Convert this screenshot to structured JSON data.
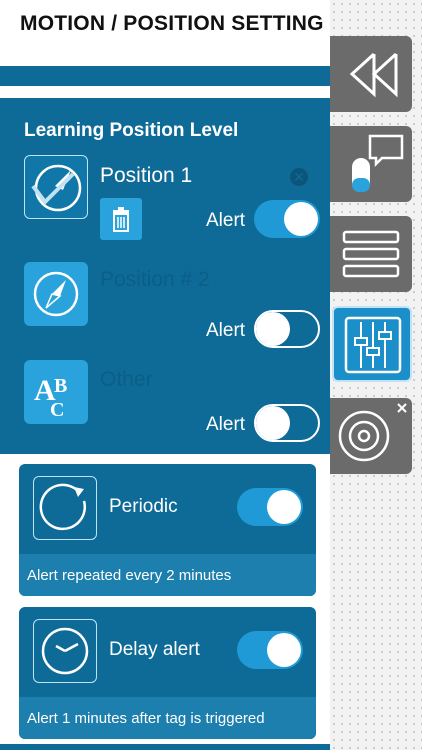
{
  "header": {
    "title": "MOTION / POSITION SETTING"
  },
  "learning": {
    "title": "Learning Position Level",
    "positions": [
      {
        "label": "Position 1",
        "alert_label": "Alert",
        "alert_on": true
      },
      {
        "label": "Position # 2",
        "alert_label": "Alert",
        "alert_on": false
      },
      {
        "label": "Other",
        "alert_label": "Alert",
        "alert_on": false
      }
    ]
  },
  "periodic": {
    "title": "Periodic",
    "note": "Alert repeated every 2 minutes",
    "enabled": true
  },
  "delay": {
    "title": "Delay alert",
    "note": "Alert 1 minutes after tag is triggered",
    "enabled": true
  },
  "sidebar": {
    "items": [
      {
        "icon": "back-arrows-icon"
      },
      {
        "icon": "chat-tag-icon"
      },
      {
        "icon": "menu-list-icon"
      },
      {
        "icon": "sliders-icon",
        "active": true
      },
      {
        "icon": "target-icon"
      }
    ]
  },
  "colors": {
    "panel_blue": "#0e6b98",
    "accent_blue": "#2aa2dc",
    "sidebar_gray": "#6b6b6b"
  }
}
